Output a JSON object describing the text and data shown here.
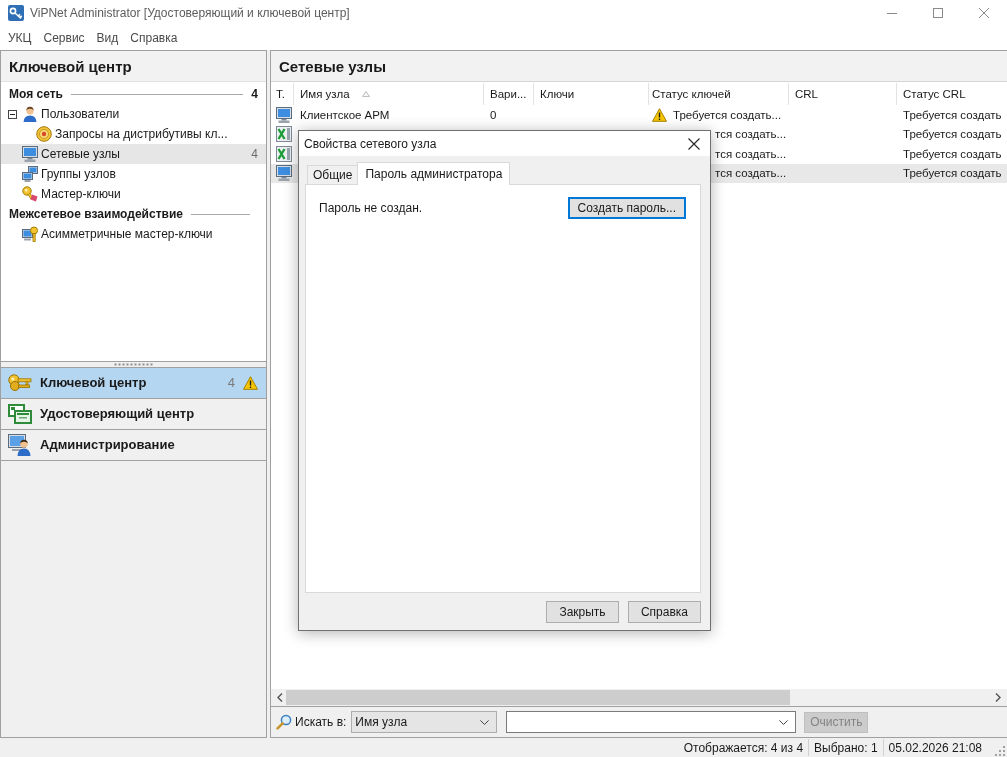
{
  "window": {
    "title": "ViPNet Administrator [Удостоверяющий и ключевой центр]"
  },
  "menu": [
    "УКЦ",
    "Сервис",
    "Вид",
    "Справка"
  ],
  "sidebar": {
    "title": "Ключевой центр",
    "sections": [
      {
        "title": "Моя сеть",
        "count": "4",
        "items": [
          {
            "kind": "users",
            "label": "Пользователи",
            "expanded": true,
            "selected": false,
            "children": [
              {
                "kind": "requests",
                "label": "Запросы на дистрибутивы кл...",
                "selected": false
              }
            ]
          },
          {
            "kind": "nodes",
            "label": "Сетевые узлы",
            "count": "4",
            "selected": true
          },
          {
            "kind": "groups",
            "label": "Группы узлов",
            "selected": false
          },
          {
            "kind": "masterkeys",
            "label": "Мастер-ключи",
            "selected": false
          }
        ]
      },
      {
        "title": "Межсетевое взаимодействие",
        "items": [
          {
            "kind": "asymkeys",
            "label": "Асимметричные мастер-ключи",
            "selected": false
          }
        ]
      }
    ],
    "nav": [
      {
        "kind": "keys",
        "label": "Ключевой центр",
        "count": "4",
        "warning": true,
        "selected": true
      },
      {
        "kind": "certs",
        "label": "Удостоверяющий центр",
        "warning": false,
        "selected": false
      },
      {
        "kind": "admin",
        "label": "Администрирование",
        "warning": false,
        "selected": false
      }
    ]
  },
  "main": {
    "title": "Сетевые узлы",
    "table": {
      "columns": [
        {
          "label": "Т.",
          "sorted": false
        },
        {
          "label": "Имя узла",
          "sorted": true
        },
        {
          "label": "Вари...",
          "sorted": false
        },
        {
          "label": "Ключи",
          "sorted": false
        },
        {
          "label": "Статус ключей",
          "sorted": false
        },
        {
          "label": "CRL",
          "sorted": false
        },
        {
          "label": "Статус CRL",
          "sorted": false
        }
      ],
      "rows": [
        {
          "kind": "client",
          "name": "Клиентское АРМ",
          "variant": "0",
          "key_status": "Требуется создать...",
          "key_warning": true,
          "crl_status": "Требуется создать",
          "covered": false,
          "selected": false
        },
        {
          "kind": "coordinator",
          "key_status": "тся создать...",
          "key_warning": false,
          "crl_status": "Требуется создать",
          "covered": true,
          "selected": false
        },
        {
          "kind": "coordinator",
          "key_status": "тся создать...",
          "key_warning": false,
          "crl_status": "Требуется создать",
          "covered": true,
          "selected": false
        },
        {
          "kind": "client",
          "key_status": "тся создать...",
          "key_warning": false,
          "crl_status": "Требуется создать",
          "covered": true,
          "selected": true
        }
      ]
    },
    "search": {
      "label": "Искать в:",
      "scope": "Имя узла",
      "clear_button": {
        "label": "Очистить",
        "disabled": true
      }
    }
  },
  "dialog": {
    "title": "Свойства сетевого узла",
    "tabs": [
      {
        "label": "Общие",
        "selected": false
      },
      {
        "label": "Пароль администратора",
        "selected": true
      }
    ],
    "message": "Пароль не создан.",
    "action": {
      "label": "Создать пароль...",
      "focused": true
    },
    "buttons": [
      "Закрыть",
      "Справка"
    ]
  },
  "status_bar": [
    "Отображается: 4 из 4",
    "Выбрано: 1",
    "05.02.2026 21:08"
  ]
}
